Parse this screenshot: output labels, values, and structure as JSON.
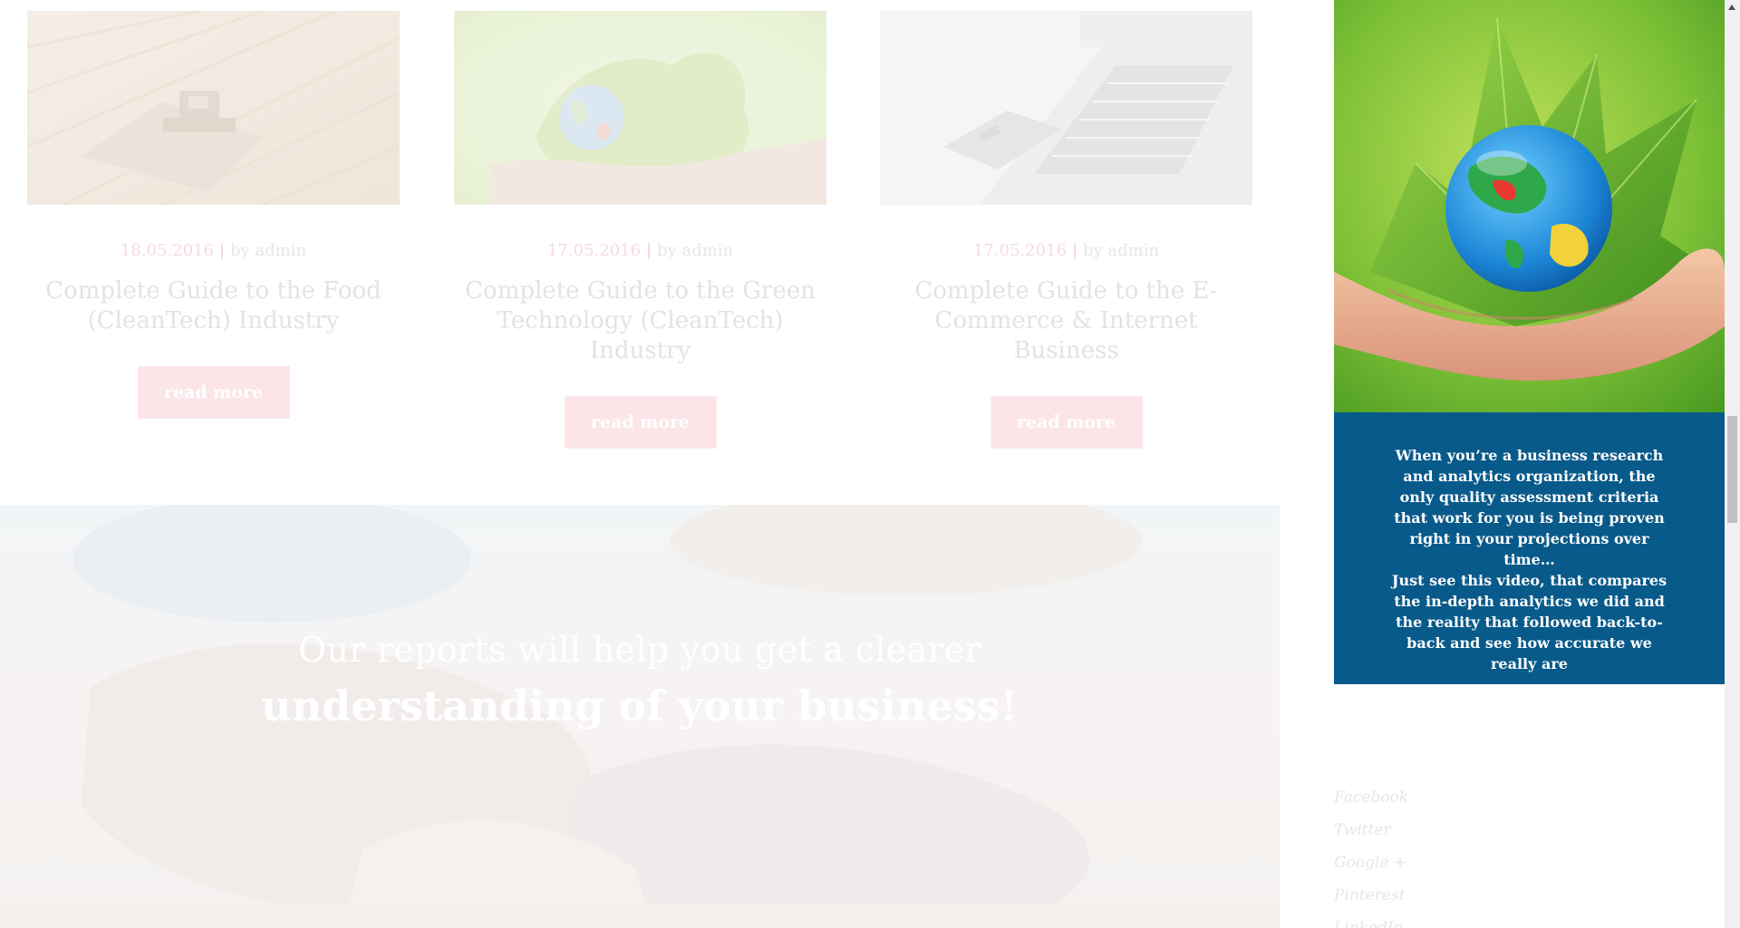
{
  "cards": [
    {
      "image": "combine-harvester-field",
      "date": "18.05.2016",
      "separator": "|",
      "author": "by admin",
      "title": "Complete Guide to the Food (CleanTech) Industry",
      "button": "read more"
    },
    {
      "image": "hands-holding-globe-leaf",
      "date": "17.05.2016",
      "separator": "|",
      "author": "by admin",
      "title": "Complete Guide to the Green Technology (CleanTech) Industry",
      "button": "read more"
    },
    {
      "image": "laptop-credit-card",
      "date": "17.05.2016",
      "separator": "|",
      "author": "by admin",
      "title": "Complete Guide to the E-Commerce & Internet Business",
      "button": "read more"
    }
  ],
  "hero": {
    "line1": "Our reports will help you get a clearer",
    "line2": "understanding of your business!"
  },
  "sidebar": {
    "image": "hand-holding-globe-in-leaves",
    "paragraph1": "When you’re a business research and analytics organization, the only quality assessment criteria that work for you is being proven right in your projections over time…",
    "paragraph2": "Just see this video, that compares the in-depth analytics we did and the reality that followed back-to-back and see how accurate we really are",
    "box_color": "#085a8a"
  },
  "social": [
    "Facebook",
    "Twitter",
    "Google +",
    "Pinterest",
    "LinkedIn"
  ],
  "colors": {
    "accent_faded": "#fbe5e8",
    "brand_blue": "#085a8a"
  }
}
